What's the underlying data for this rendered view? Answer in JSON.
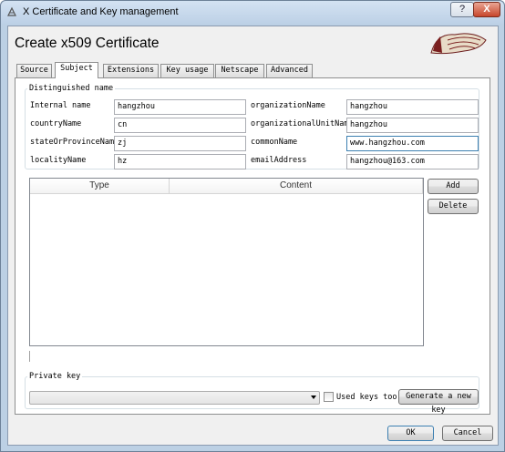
{
  "window": {
    "title": "X Certificate and Key management",
    "help_label": "?",
    "close_label": "X"
  },
  "page": {
    "heading": "Create x509 Certificate"
  },
  "tabs": [
    {
      "label": "Source",
      "active": false
    },
    {
      "label": "Subject",
      "active": true
    },
    {
      "label": "Extensions",
      "active": false
    },
    {
      "label": "Key usage",
      "active": false
    },
    {
      "label": "Netscape",
      "active": false
    },
    {
      "label": "Advanced",
      "active": false
    }
  ],
  "dn": {
    "group_label": "Distinguished name",
    "fields": {
      "internal_name": {
        "label": "Internal name",
        "value": "hangzhou"
      },
      "country": {
        "label": "countryName",
        "value": "cn"
      },
      "state": {
        "label": "stateOrProvinceName",
        "value": "zj"
      },
      "locality": {
        "label": "localityName",
        "value": "hz"
      },
      "org": {
        "label": "organizationName",
        "value": "hangzhou"
      },
      "org_unit": {
        "label": "organizationalUnitName",
        "value": "hangzhou"
      },
      "common": {
        "label": "commonName",
        "value": "www.hangzhou.com"
      },
      "email": {
        "label": "emailAddress",
        "value": "hangzhou@163.com"
      }
    }
  },
  "table": {
    "columns": [
      "Type",
      "Content"
    ]
  },
  "buttons": {
    "add": "Add",
    "delete": "Delete",
    "generate": "Generate a new key",
    "ok": "OK",
    "cancel": "Cancel"
  },
  "private_key": {
    "group_label": "Private key",
    "selected": "",
    "used_keys_label": "Used keys too",
    "used_keys_checked": false
  }
}
